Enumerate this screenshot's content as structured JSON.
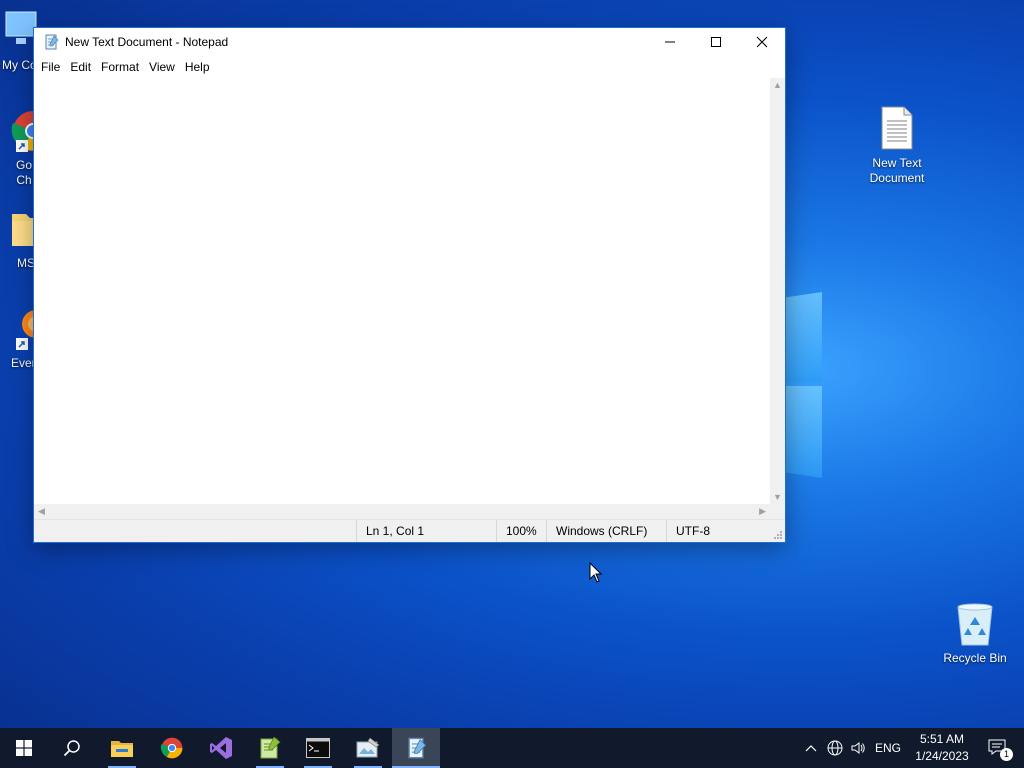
{
  "desktop": {
    "left_icons": [
      {
        "label": "My Co",
        "icon": "this-pc-icon"
      },
      {
        "label": "Go\nCh",
        "icon": "google-chrome-icon"
      },
      {
        "label": "MS",
        "icon": "folder-icon"
      },
      {
        "label": "Ever",
        "icon": "everything-search-icon"
      }
    ],
    "new_text_document": {
      "label_line1": "New Text",
      "label_line2": "Document",
      "icon": "text-document-icon"
    },
    "recycle_bin": {
      "label": "Recycle Bin",
      "icon": "recycle-bin-icon"
    }
  },
  "notepad": {
    "title": "New Text Document - Notepad",
    "icon": "notepad-icon",
    "menu": [
      "File",
      "Edit",
      "Format",
      "View",
      "Help"
    ],
    "content": "",
    "status": {
      "position": "Ln 1, Col 1",
      "zoom": "100%",
      "line_ending": "Windows (CRLF)",
      "encoding": "UTF-8"
    }
  },
  "taskbar": {
    "apps": [
      {
        "name": "start",
        "icon": "windows-start-icon"
      },
      {
        "name": "search",
        "icon": "search-icon"
      },
      {
        "name": "file-explorer",
        "icon": "file-explorer-icon"
      },
      {
        "name": "chrome",
        "icon": "google-chrome-icon"
      },
      {
        "name": "visual-studio",
        "icon": "visual-studio-icon"
      },
      {
        "name": "notepad-plus-plus",
        "icon": "notepad-plus-plus-icon"
      },
      {
        "name": "command-prompt",
        "icon": "command-prompt-icon"
      },
      {
        "name": "paint",
        "icon": "paint-icon"
      },
      {
        "name": "notepad",
        "icon": "notepad-icon",
        "active": true
      }
    ],
    "tray": {
      "language": "ENG",
      "time": "5:51 AM",
      "date": "1/24/2023",
      "notification_count": "1"
    }
  },
  "colors": {
    "taskbar_bg": "#101a2c",
    "window_border": "#1f6fd1",
    "statusbar_bg": "#f0f0f0"
  }
}
